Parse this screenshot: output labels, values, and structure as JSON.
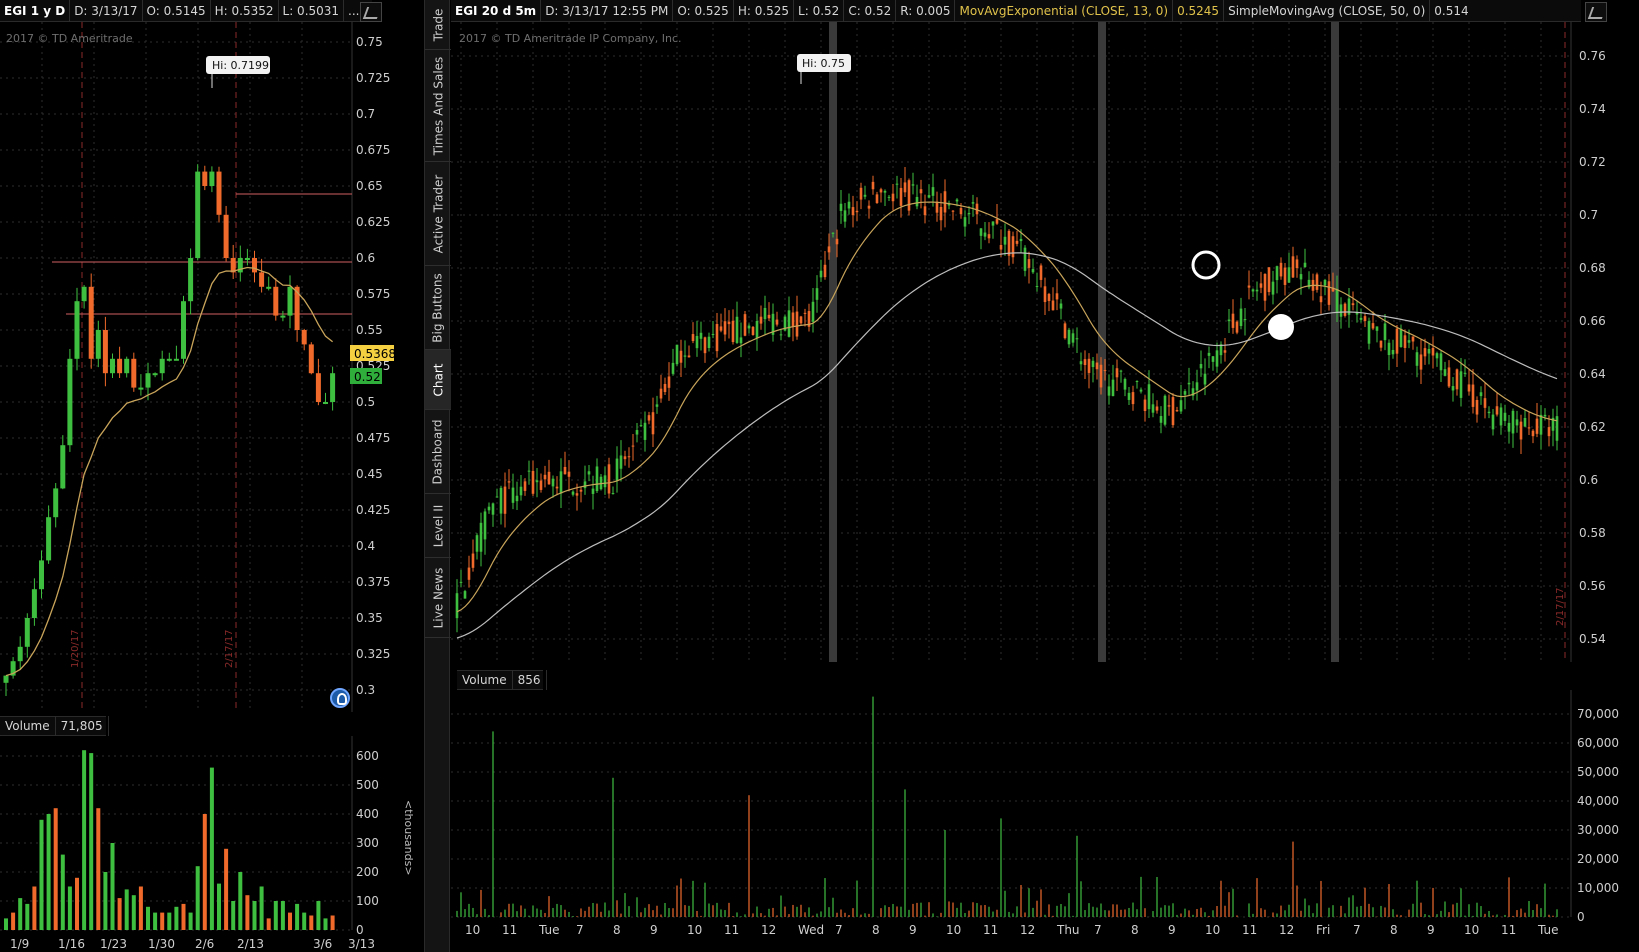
{
  "left": {
    "header": {
      "symbol": "EGI 1 y D",
      "date": "D: 3/13/17",
      "open": "O: 0.5145",
      "high": "H: 0.5352",
      "low": "L: 0.5031",
      "more": "..."
    },
    "watermark": "2017 © TD Ameritrade",
    "hi_label": "Hi: 0.7199",
    "price_axis": [
      "0.75",
      "0.725",
      "0.7",
      "0.675",
      "0.65",
      "0.625",
      "0.6",
      "0.575",
      "0.55",
      "0.525",
      "0.5",
      "0.475",
      "0.45",
      "0.425",
      "0.4",
      "0.375",
      "0.35",
      "0.325",
      "0.3"
    ],
    "badge_yellow": "0.5368",
    "badge_green": "0.52",
    "date_markers": [
      "1/20/17",
      "2/17/17"
    ],
    "x_axis": [
      "1/9",
      "1/16",
      "1/23",
      "1/30",
      "2/6",
      "2/13",
      "3/6",
      "3/13"
    ],
    "volume_title": "Volume",
    "volume_value": "71,805",
    "volume_axis": [
      "600",
      "500",
      "400",
      "300",
      "200",
      "100",
      "0"
    ],
    "thousands_label": "<thousands>"
  },
  "tabs": [
    "Trade",
    "Times And Sales",
    "Active Trader",
    "Big Buttons",
    "Chart",
    "Dashboard",
    "Level II",
    "Live News"
  ],
  "active_tab": "Chart",
  "right": {
    "header": {
      "symbol": "EGI 20 d 5m",
      "date": "D: 3/13/17 12:55 PM",
      "open": "O: 0.525",
      "high": "H: 0.525",
      "low": "L: 0.52",
      "close": "C: 0.52",
      "range": "R: 0.005",
      "ema": "MovAvgExponential (CLOSE, 13, 0)",
      "ema_value": "0.5245",
      "sma": "SimpleMovingAvg (CLOSE, 50, 0)",
      "sma_value": "0.514"
    },
    "watermark": "2017 © TD Ameritrade IP Company, Inc.",
    "hi_label": "Hi: 0.75",
    "price_axis": [
      "0.76",
      "0.74",
      "0.72",
      "0.7",
      "0.68",
      "0.66",
      "0.64",
      "0.62",
      "0.6",
      "0.58",
      "0.56",
      "0.54"
    ],
    "date_marker": "2/17/17",
    "x_axis": [
      "10",
      "11",
      "Tue",
      "7",
      "8",
      "9",
      "10",
      "11",
      "12",
      "Wed",
      "7",
      "8",
      "9",
      "10",
      "11",
      "12",
      "Thu",
      "7",
      "8",
      "9",
      "10",
      "11",
      "12",
      "Fri",
      "7",
      "8",
      "9",
      "10",
      "11",
      "Tue"
    ],
    "volume_title": "Volume",
    "volume_value": "856",
    "volume_axis": [
      "70,000",
      "60,000",
      "50,000",
      "40,000",
      "30,000",
      "20,000",
      "10,000",
      "0"
    ]
  },
  "colors": {
    "up": "#3fbf3f",
    "down": "#ef6a2b",
    "ema": "#c8a45a",
    "sma": "#bdbdbd",
    "grid": "#2e2e2e",
    "level_line": "#d06060",
    "badge_yellow": "#f5d142",
    "badge_green": "#2fae3c"
  }
}
